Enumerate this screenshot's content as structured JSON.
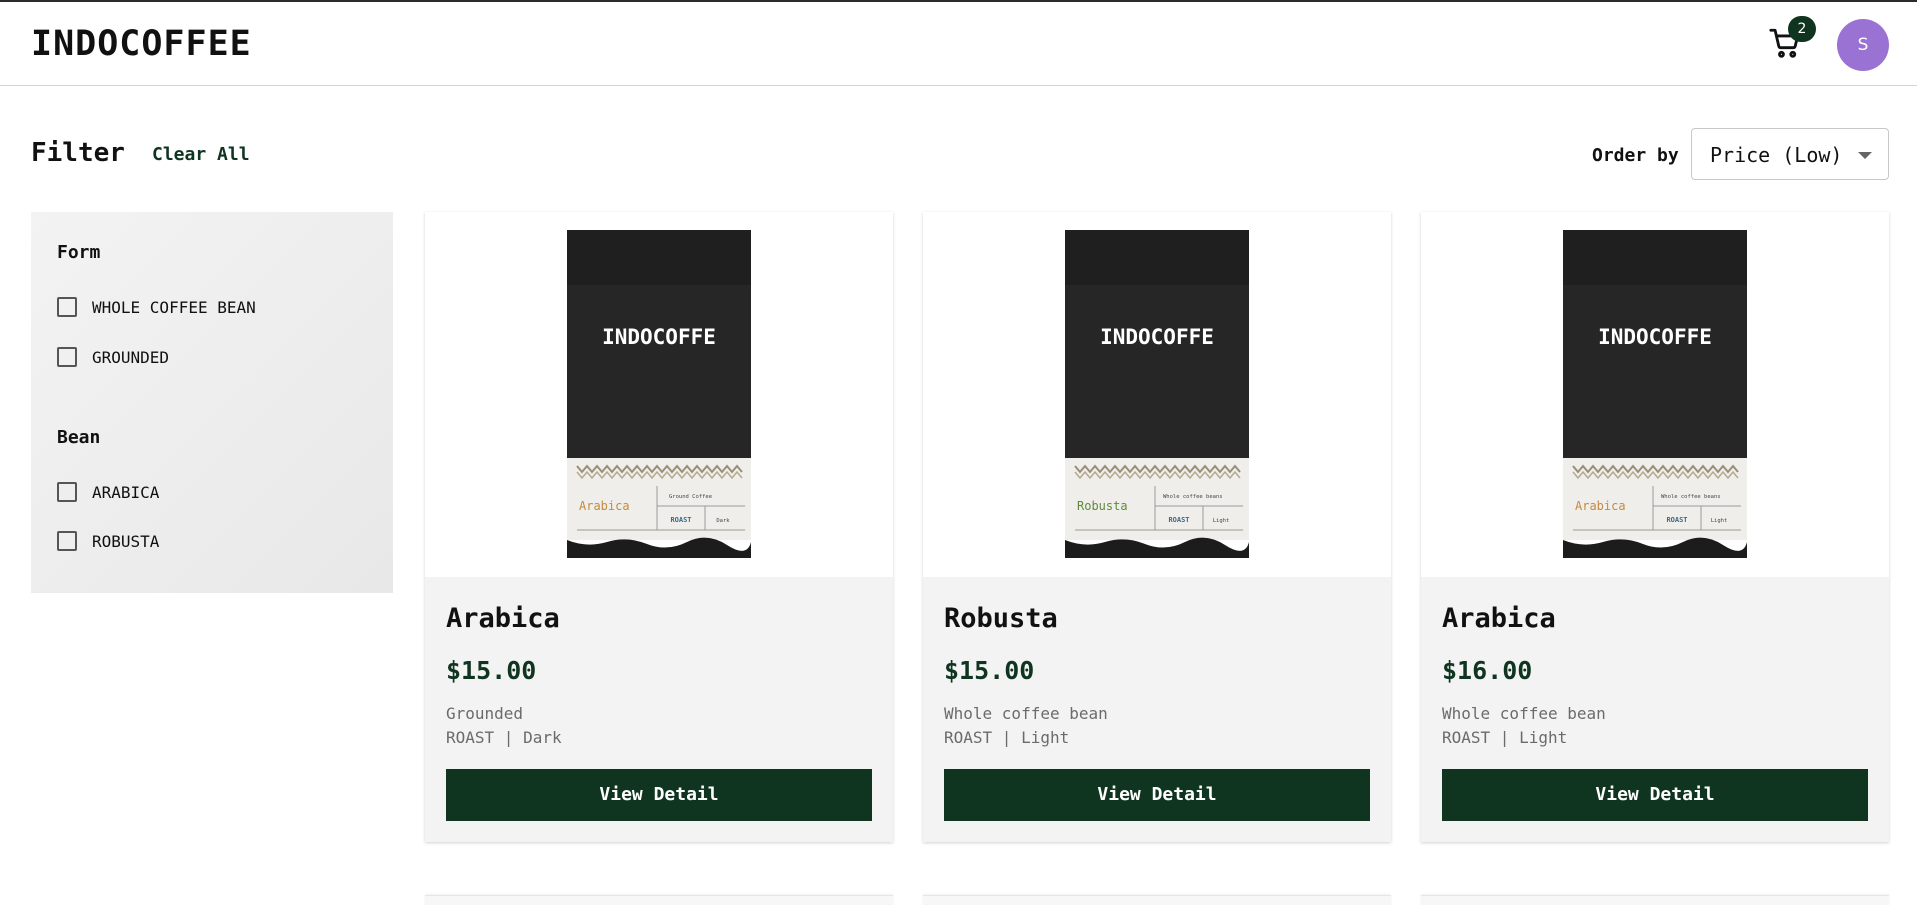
{
  "header": {
    "logo": "INDOCOFFEE",
    "cart_count": "2",
    "user_initial": "S"
  },
  "toolbar": {
    "filter_title": "Filter",
    "clear_all": "Clear All",
    "order_label": "Order by",
    "order_value": "Price (Low)"
  },
  "filters": {
    "form": {
      "title": "Form",
      "options": [
        "WHOLE COFFEE BEAN",
        "GROUNDED"
      ]
    },
    "bean": {
      "title": "Bean",
      "options": [
        "ARABICA",
        "ROBUSTA"
      ]
    }
  },
  "products": [
    {
      "name": "Arabica",
      "price": "$15.00",
      "form": "Grounded",
      "roast": "ROAST | Dark",
      "button": "View Detail",
      "bag": {
        "brand": "INDOCOFFE",
        "variety": "Arabica",
        "variety_color": "#c58a3c",
        "form": "Ground Coffee",
        "roast_word": "ROAST",
        "roast_level": "Dark"
      }
    },
    {
      "name": "Robusta",
      "price": "$15.00",
      "form": "Whole coffee bean",
      "roast": "ROAST | Light",
      "button": "View Detail",
      "bag": {
        "brand": "INDOCOFFE",
        "variety": "Robusta",
        "variety_color": "#5f8a3c",
        "form": "Whole coffee beans",
        "roast_word": "ROAST",
        "roast_level": "Light"
      }
    },
    {
      "name": "Arabica",
      "price": "$16.00",
      "form": "Whole coffee bean",
      "roast": "ROAST | Light",
      "button": "View Detail",
      "bag": {
        "brand": "INDOCOFFE",
        "variety": "Arabica",
        "variety_color": "#c58a3c",
        "form": "Whole coffee beans",
        "roast_word": "ROAST",
        "roast_level": "Light"
      }
    }
  ],
  "colors": {
    "brand_green": "#0f3520",
    "avatar": "#9a72d3"
  }
}
